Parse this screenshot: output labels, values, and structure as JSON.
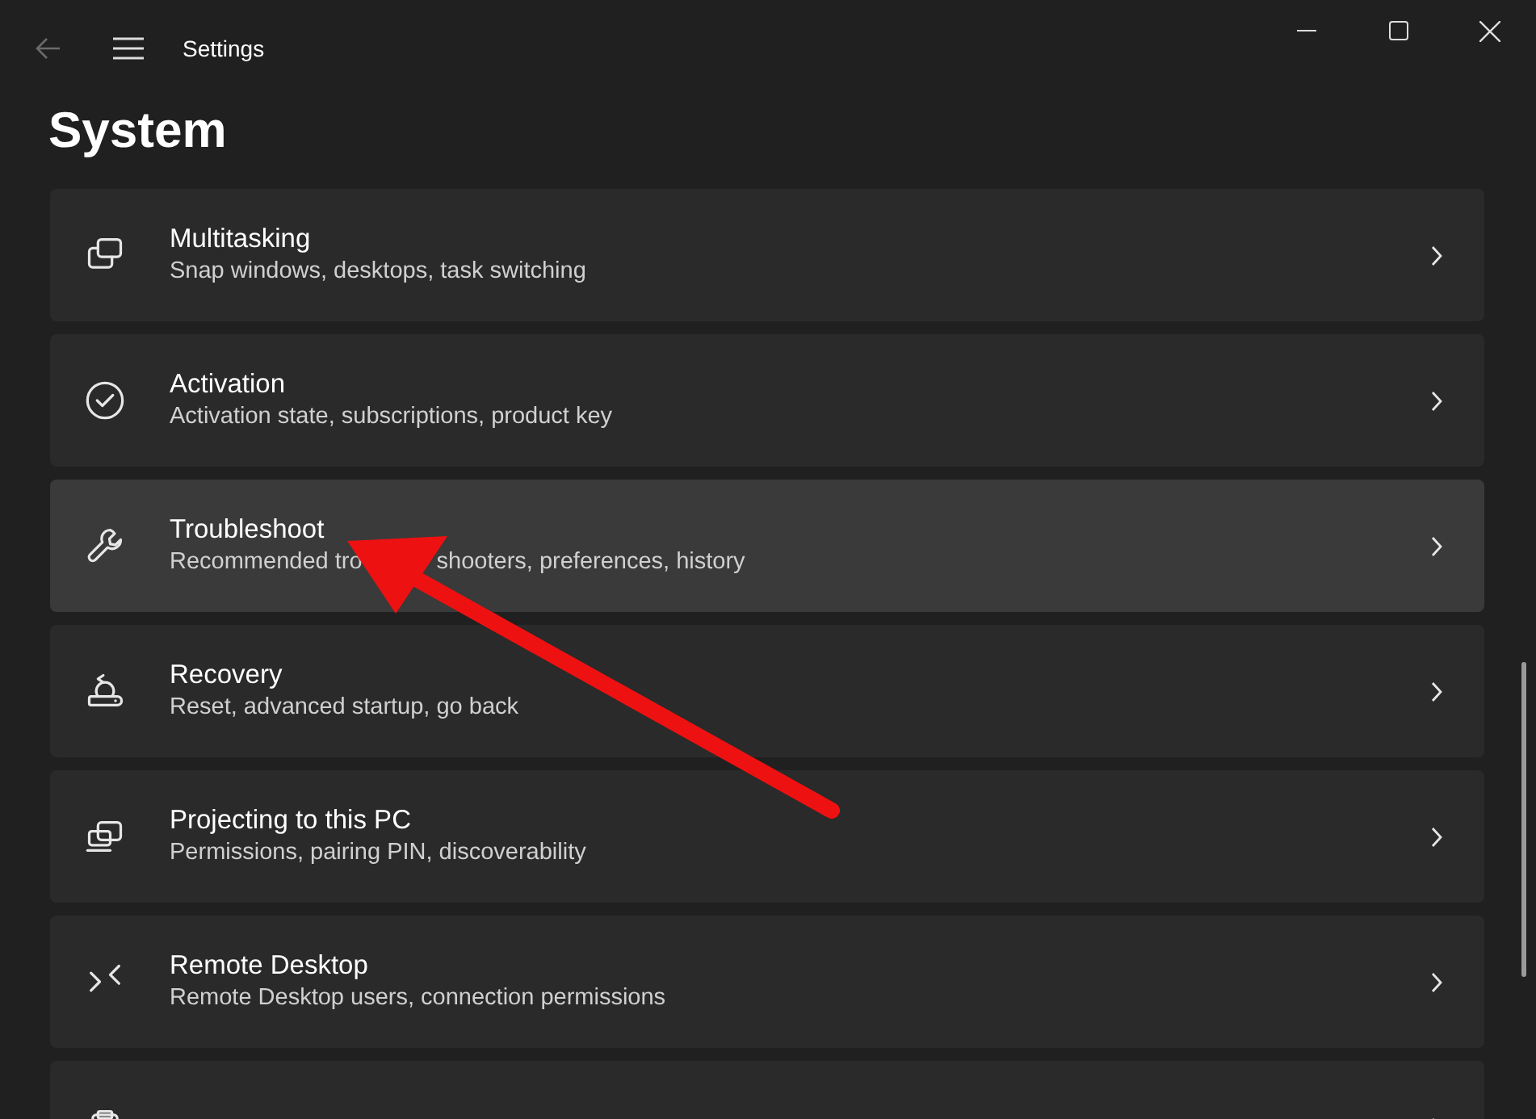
{
  "window": {
    "title": "Settings"
  },
  "page_title": "System",
  "items": [
    {
      "kind": "multitasking",
      "title": "Multitasking",
      "subtitle": [
        "Snap windows, desktops, task switching"
      ],
      "highlighted": false
    },
    {
      "kind": "activation",
      "title": "Activation",
      "subtitle": [
        "Activation state, subscriptions, product key"
      ],
      "highlighted": false
    },
    {
      "kind": "troubleshoot",
      "title": "Troubleshoot",
      "subtitle": [
        "Recommended tro",
        "shooters, preferences, history"
      ],
      "highlighted": true
    },
    {
      "kind": "recovery",
      "title": "Recovery",
      "subtitle": [
        "Reset, advanced startup, go back"
      ],
      "highlighted": false
    },
    {
      "kind": "projecting",
      "title": "Projecting to this PC",
      "subtitle": [
        "Permissions, pairing PIN, discoverability"
      ],
      "highlighted": false
    },
    {
      "kind": "remote",
      "title": "Remote Desktop",
      "subtitle": [
        "Remote Desktop users, connection permissions"
      ],
      "highlighted": false
    },
    {
      "kind": "clipboard",
      "highlighted": false
    }
  ]
}
